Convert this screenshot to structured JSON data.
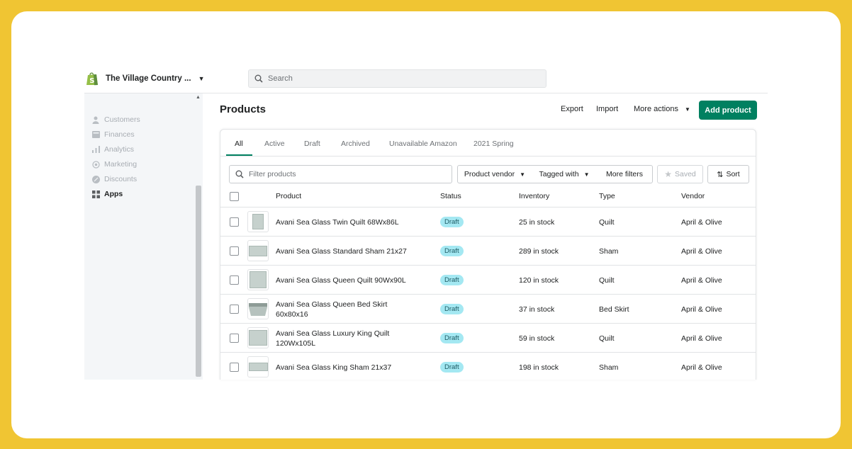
{
  "store": {
    "name": "The Village Country ...",
    "logo_icon": "shopify-bag-icon",
    "caret_icon": "caret-down-icon"
  },
  "search": {
    "placeholder": "Search"
  },
  "sidebar": {
    "items": [
      {
        "label": "Customers",
        "icon": "person-icon",
        "active": false
      },
      {
        "label": "Finances",
        "icon": "finance-icon",
        "active": false
      },
      {
        "label": "Analytics",
        "icon": "bar-chart-icon",
        "active": false
      },
      {
        "label": "Marketing",
        "icon": "target-icon",
        "active": false
      },
      {
        "label": "Discounts",
        "icon": "discount-icon",
        "active": false
      },
      {
        "label": "Apps",
        "icon": "apps-grid-icon",
        "active": true
      }
    ]
  },
  "page": {
    "title": "Products",
    "export_label": "Export",
    "import_label": "Import",
    "more_actions_label": "More actions",
    "add_product_label": "Add product"
  },
  "tabs": [
    "All",
    "Active",
    "Draft",
    "Archived",
    "Unavailable Amazon",
    "2021 Spring"
  ],
  "filters": {
    "placeholder": "Filter products",
    "vendor_label": "Product vendor",
    "tagged_label": "Tagged with",
    "more_filters_label": "More filters",
    "saved_label": "Saved",
    "sort_label": "Sort"
  },
  "table": {
    "headers": {
      "product": "Product",
      "status": "Status",
      "inventory": "Inventory",
      "type": "Type",
      "vendor": "Vendor"
    },
    "rows": [
      {
        "name": "Avani Sea Glass Twin Quilt 68Wx86L",
        "status": "Draft",
        "inventory": "25 in stock",
        "type": "Quilt",
        "vendor": "April & Olive"
      },
      {
        "name": "Avani Sea Glass Standard Sham 21x27",
        "status": "Draft",
        "inventory": "289 in stock",
        "type": "Sham",
        "vendor": "April & Olive"
      },
      {
        "name": "Avani Sea Glass Queen Quilt 90Wx90L",
        "status": "Draft",
        "inventory": "120 in stock",
        "type": "Quilt",
        "vendor": "April & Olive"
      },
      {
        "name": "Avani Sea Glass Queen Bed Skirt 60x80x16",
        "status": "Draft",
        "inventory": "37 in stock",
        "type": "Bed Skirt",
        "vendor": "April & Olive"
      },
      {
        "name": "Avani Sea Glass Luxury King Quilt 120Wx105L",
        "status": "Draft",
        "inventory": "59 in stock",
        "type": "Quilt",
        "vendor": "April & Olive"
      },
      {
        "name": "Avani Sea Glass King Sham 21x37",
        "status": "Draft",
        "inventory": "198 in stock",
        "type": "Sham",
        "vendor": "April & Olive"
      }
    ]
  },
  "colors": {
    "frame": "#f0c533",
    "primary": "#008060",
    "draft_badge": "#a4e8f2"
  }
}
